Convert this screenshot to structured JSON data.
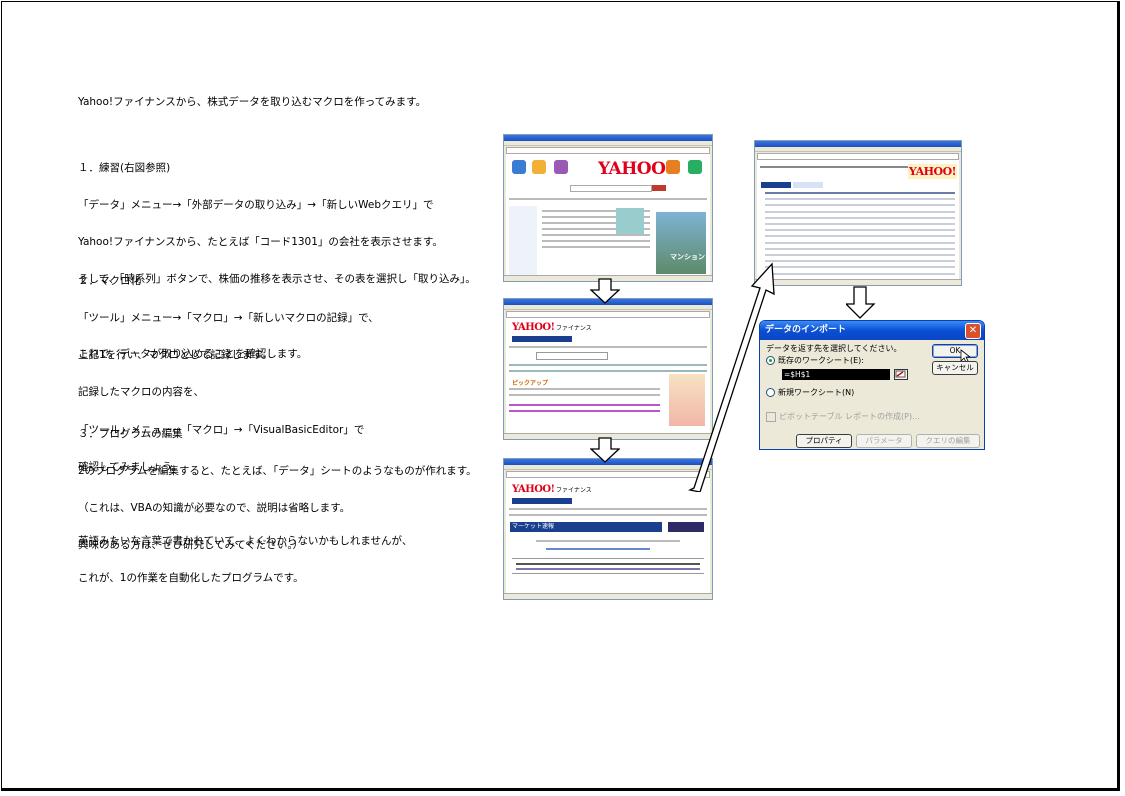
{
  "intro": "Yahoo!ファイナンスから、株式データを取り込むマクロを作ってみます。",
  "section1": {
    "lines": [
      "１．練習(右図参照)",
      "「データ」メニュー→「外部データの取り込み」→「新しいWebクエリ」で",
      "Yahoo!ファイナンスから、たとえば「コード1301」の会社を表示させます。",
      "そして、「時系列」ボタンで、株価の推移を表示させ、その表を選択し「取り込み」。",
      "",
      "これで、データが取り込めることを確認します。"
    ]
  },
  "section2": {
    "lines": [
      "２．マクロ化",
      "「ツール」メニュー→「マクロ」→「新しいマクロの記録」で、",
      "上記1を行い、マクロとして記録します。",
      "記録したマクロの内容を、",
      "「ツール」メニュー→「マクロ」→「VisualBasicEditor」で",
      "確認してみましょう。",
      "",
      "英語みたいな言葉で書かれていて、よくわからないかもしれませんが、",
      "これが、1の作業を自動化したプログラムです。"
    ]
  },
  "section3": {
    "lines": [
      "３．プログラムの編集",
      "2のプログラムを編集すると、たとえば、「データ」シートのようなものが作れます。",
      "（これは、VBAの知識が必要なので、説明は省略します。",
      "興味のある方は、ぜひ研究してみてください。）"
    ]
  },
  "screenshots": {
    "yahoo_logo": "YAHOO!",
    "finance_label": "ファイナンス",
    "pickup": "ピックアップ",
    "market": "マーケット速報",
    "mansion": "マンション"
  },
  "dialog": {
    "title": "データのインポート",
    "prompt": "データを返す先を選択してください。",
    "option_existing": "既存のワークシート(E):",
    "cell_ref": "=$H$1",
    "option_new": "新規ワークシート(N)",
    "pivot_link": "ピボットテーブル レポートの作成(P)...",
    "ok": "OK",
    "cancel": "キャンセル",
    "properties": "プロパティ(R)...",
    "parameters": "パラメータ(M)...",
    "edit_query": "クエリの編集(Q)..."
  },
  "colors": {
    "yahoo_red": "#e0001a",
    "xp_title_blue": "#0a4fd6",
    "finance_blue": "#1b3f8f"
  }
}
